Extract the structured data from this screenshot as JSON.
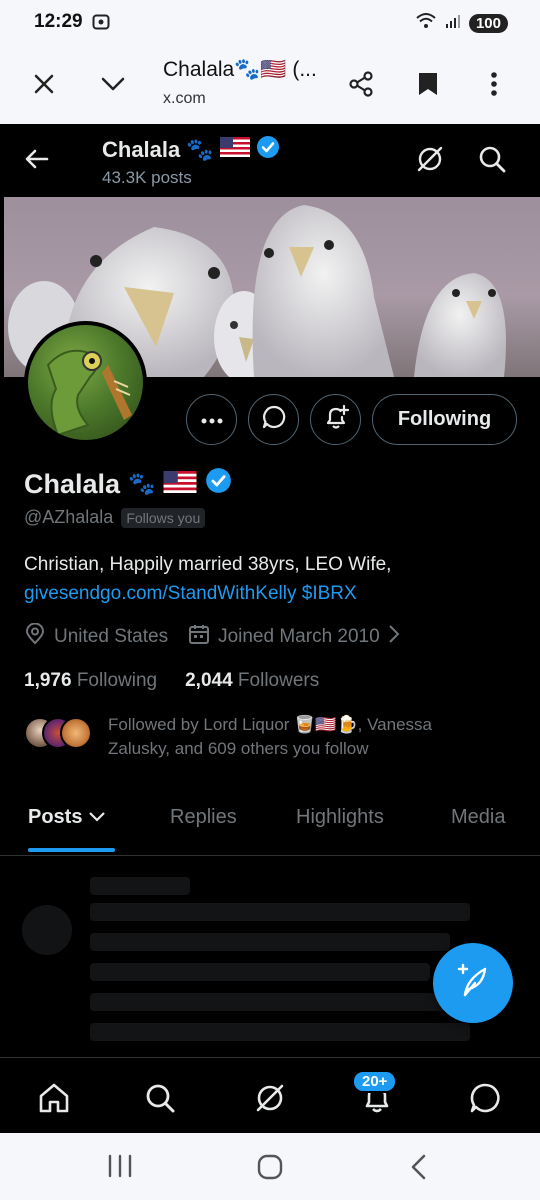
{
  "status_bar": {
    "time": "12:29",
    "battery": "100"
  },
  "browser": {
    "page_title": "Chalala🐾🇺🇸 (...",
    "url": "x.com"
  },
  "header": {
    "name": "Chalala",
    "posts_count": "43.3K posts"
  },
  "profile": {
    "display_name": "Chalala",
    "handle": "@AZhalala",
    "follows_you": "Follows you",
    "bio_text": "Christian, Happily married 38yrs, LEO Wife,",
    "bio_link": "givesendgo.com/StandWithKelly",
    "bio_cashtag": "$IBRX",
    "location": "United States",
    "joined": "Joined March 2010",
    "following_count": "1,976",
    "following_label": "Following",
    "followers_count": "2,044",
    "followers_label": "Followers",
    "followed_by_prefix": "Followed by Lord Liquor 🥃🇺🇸🍺, Vanessa",
    "followed_by_suffix": "Zalusky, and 609 others you follow"
  },
  "actions": {
    "following_button": "Following"
  },
  "tabs": [
    {
      "label": "Posts"
    },
    {
      "label": "Replies"
    },
    {
      "label": "Highlights"
    },
    {
      "label": "Media"
    }
  ],
  "bottom_nav": {
    "notifications_badge": "20+"
  },
  "colors": {
    "accent": "#1d9bf0",
    "background": "#000000",
    "text_primary": "#e7e9ea",
    "text_secondary": "#71767b"
  },
  "icons": [
    "close-icon",
    "chevron-down-icon",
    "share-icon",
    "bookmark-icon",
    "more-vert-icon",
    "back-arrow-icon",
    "grok-icon",
    "search-icon",
    "more-horiz-icon",
    "message-icon",
    "bell-plus-icon",
    "verified-icon",
    "location-icon",
    "calendar-icon",
    "compose-icon",
    "home-icon",
    "bell-icon"
  ]
}
